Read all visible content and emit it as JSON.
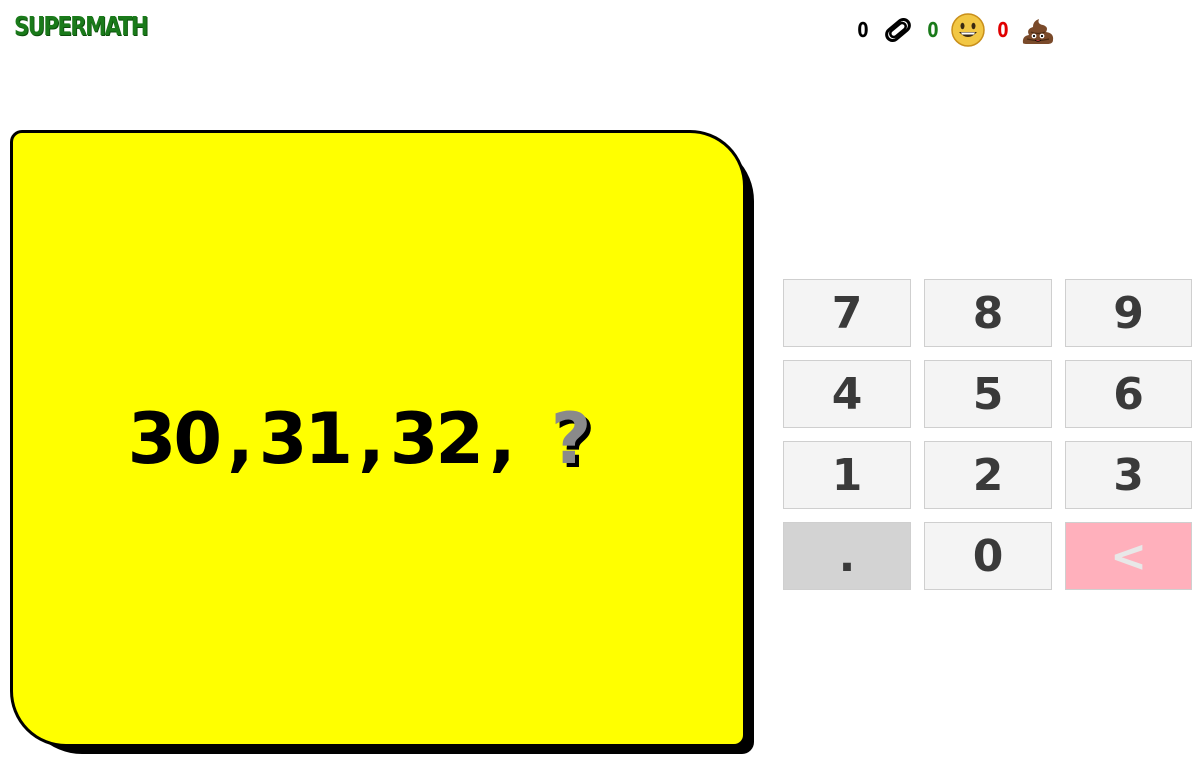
{
  "app": {
    "title": "SUPERMATH"
  },
  "score": {
    "hints": {
      "count": "0",
      "icon": "paperclip-icon",
      "color": "#000000"
    },
    "correct": {
      "count": "0",
      "icon": "smiley-icon",
      "color": "#1a7a1a"
    },
    "wrong": {
      "count": "0",
      "icon": "poop-icon",
      "color": "#e00000"
    }
  },
  "question": {
    "terms": [
      "30",
      "31",
      "32"
    ],
    "separator": ",",
    "unknown": "?"
  },
  "keypad": {
    "keys": [
      "7",
      "8",
      "9",
      "4",
      "5",
      "6",
      "1",
      "2",
      "3",
      ".",
      "0",
      "<"
    ]
  },
  "colors": {
    "card": "#ffff00",
    "logo": "#1a7a1a",
    "backspace": "#ffb0bc"
  }
}
